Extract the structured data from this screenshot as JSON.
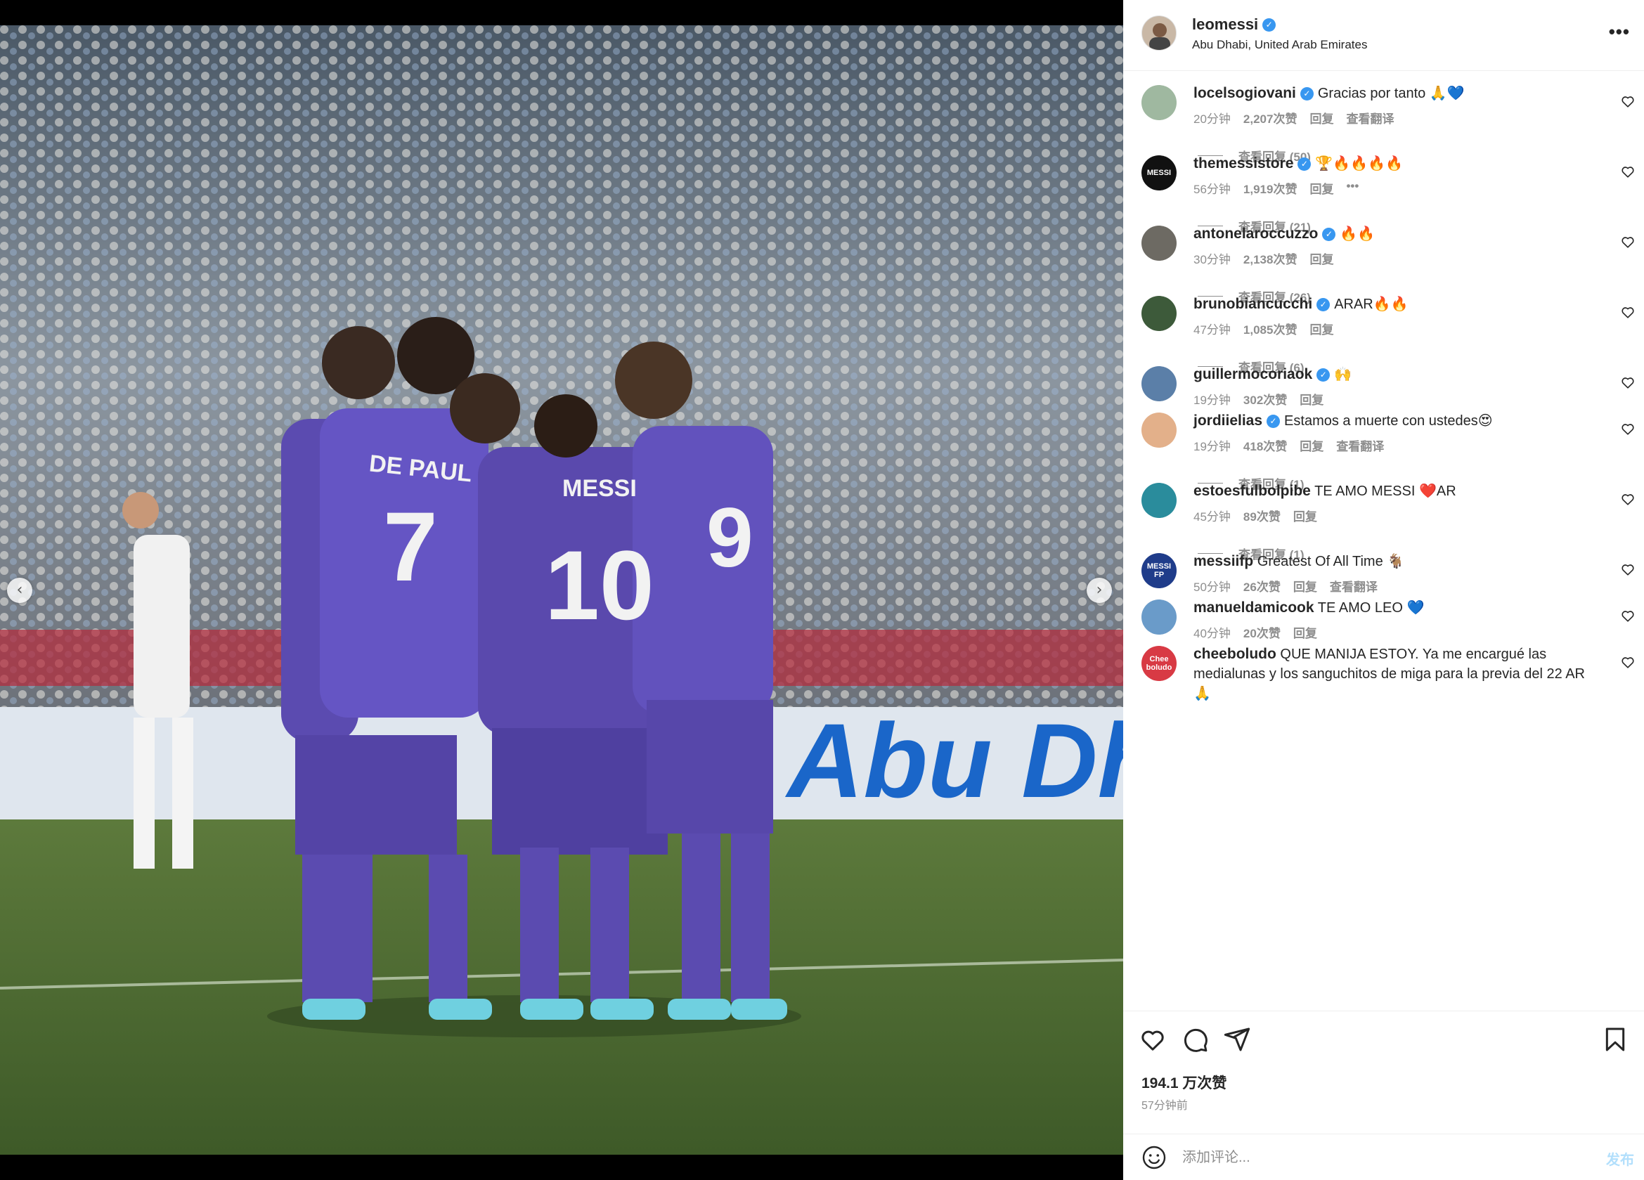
{
  "post": {
    "username": "leomessi",
    "location": "Abu Dhabi, United Arab Emirates",
    "likes": "194.1 万次赞",
    "time_ago": "57分钟前",
    "comment_placeholder": "添加评论...",
    "post_label": "发布",
    "carousel_slides": 6,
    "carousel_active": 2
  },
  "photo": {
    "ad_board_text": "Abu Dh",
    "jersey_names": [
      "DE PAUL",
      "MESSI"
    ],
    "jersey_numbers": [
      "7",
      "10",
      "9"
    ]
  },
  "comments": [
    {
      "user": "locelsogiovani",
      "verified": true,
      "text": "Gracias por tanto 🙏💙",
      "time": "20分钟",
      "likes": "2,207次赞",
      "reply": "回复",
      "translate": "查看翻译",
      "view_replies": "查看回复 (50)"
    },
    {
      "user": "themessistore",
      "verified": true,
      "text": "🏆🔥🔥🔥🔥",
      "time": "56分钟",
      "likes": "1,919次赞",
      "reply": "回复",
      "options": "•••",
      "view_replies": "查看回复 (21)"
    },
    {
      "user": "antonelaroccuzzo",
      "verified": true,
      "text": "🔥🔥",
      "time": "30分钟",
      "likes": "2,138次赞",
      "reply": "回复",
      "view_replies": "查看回复 (26)"
    },
    {
      "user": "brunobiancucchi",
      "verified": true,
      "text": "ARAR🔥🔥",
      "time": "47分钟",
      "likes": "1,085次赞",
      "reply": "回复",
      "view_replies": "查看回复 (6)"
    },
    {
      "user": "guillermocoriaok",
      "verified": true,
      "text": "🙌",
      "time": "19分钟",
      "likes": "302次赞",
      "reply": "回复"
    },
    {
      "user": "jordiielias",
      "verified": true,
      "text": "Estamos a muerte con ustedes😍",
      "time": "19分钟",
      "likes": "418次赞",
      "reply": "回复",
      "translate": "查看翻译",
      "view_replies": "查看回复 (1)"
    },
    {
      "user": "estoesfulbolpibe",
      "verified": false,
      "text": "TE AMO MESSI ❤️AR",
      "time": "45分钟",
      "likes": "89次赞",
      "reply": "回复",
      "view_replies": "查看回复 (1)"
    },
    {
      "user": "messiifp",
      "verified": false,
      "text": "Greatest Of All Time 🐐",
      "time": "50分钟",
      "likes": "26次赞",
      "reply": "回复",
      "translate": "查看翻译"
    },
    {
      "user": "manueldamicook",
      "verified": false,
      "text": "TE AMO LEO 💙",
      "time": "40分钟",
      "likes": "20次赞",
      "reply": "回复"
    },
    {
      "user": "cheeboludo",
      "verified": false,
      "text": "QUE MANIJA ESTOY. Ya me encargué las medialunas y los sanguchitos de miga para la previa del 22 AR 🙏"
    }
  ],
  "avatars": [
    {
      "bg": "#9fb8a0",
      "label": ""
    },
    {
      "bg": "#111111",
      "label": "MESSI"
    },
    {
      "bg": "#6d6a63",
      "label": ""
    },
    {
      "bg": "#3d5a3a",
      "label": ""
    },
    {
      "bg": "#5b7fa8",
      "label": ""
    },
    {
      "bg": "#e3b08a",
      "label": ""
    },
    {
      "bg": "#2a8c9c",
      "label": ""
    },
    {
      "bg": "#1f3c8a",
      "label": "MESSI FP"
    },
    {
      "bg": "#6a9bc9",
      "label": ""
    },
    {
      "bg": "#d83a44",
      "label": "Chee boludo"
    }
  ],
  "colors": {
    "verified": "#3897f0",
    "muted_text": "#8e8e8e",
    "post_button": "#b2dffc",
    "jersey": "#5b4bb0"
  }
}
